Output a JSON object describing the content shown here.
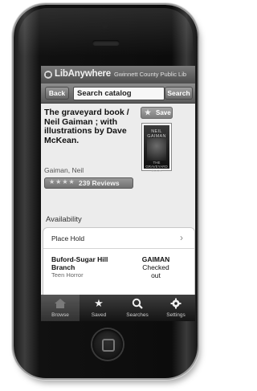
{
  "header": {
    "app_name": "LibAnywhere",
    "library_name": "Gwinnett County Public Lib"
  },
  "navbar": {
    "back_label": "Back",
    "search_value": "Search catalog",
    "search_button_label": "Search"
  },
  "book": {
    "title": "The graveyard book / Neil Gaiman ; with illustrations by Dave McKean.",
    "author": "Gaiman, Neil",
    "save_label": "Save",
    "rating_stars": "★★★★",
    "rating": 4,
    "reviews_label": "239 Reviews",
    "cover_author": "NEIL GAIMAN",
    "cover_title": "THE GRAVEYARD BOOK"
  },
  "availability": {
    "heading": "Availability",
    "place_hold_label": "Place Hold",
    "branch": "Buford-Sugar Hill Branch",
    "collection": "Teen Horror",
    "call_number": "GAIMAN",
    "status": "Checked out"
  },
  "tabs": [
    {
      "label": "Browse",
      "icon": "home-icon"
    },
    {
      "label": "Saved",
      "icon": "star-icon"
    },
    {
      "label": "Searches",
      "icon": "search-icon"
    },
    {
      "label": "Settings",
      "icon": "gear-icon"
    }
  ],
  "colors": {
    "topbar": "#5a5a5a",
    "tabbar": "#1e1e1e",
    "content_bg": "#ececec"
  }
}
